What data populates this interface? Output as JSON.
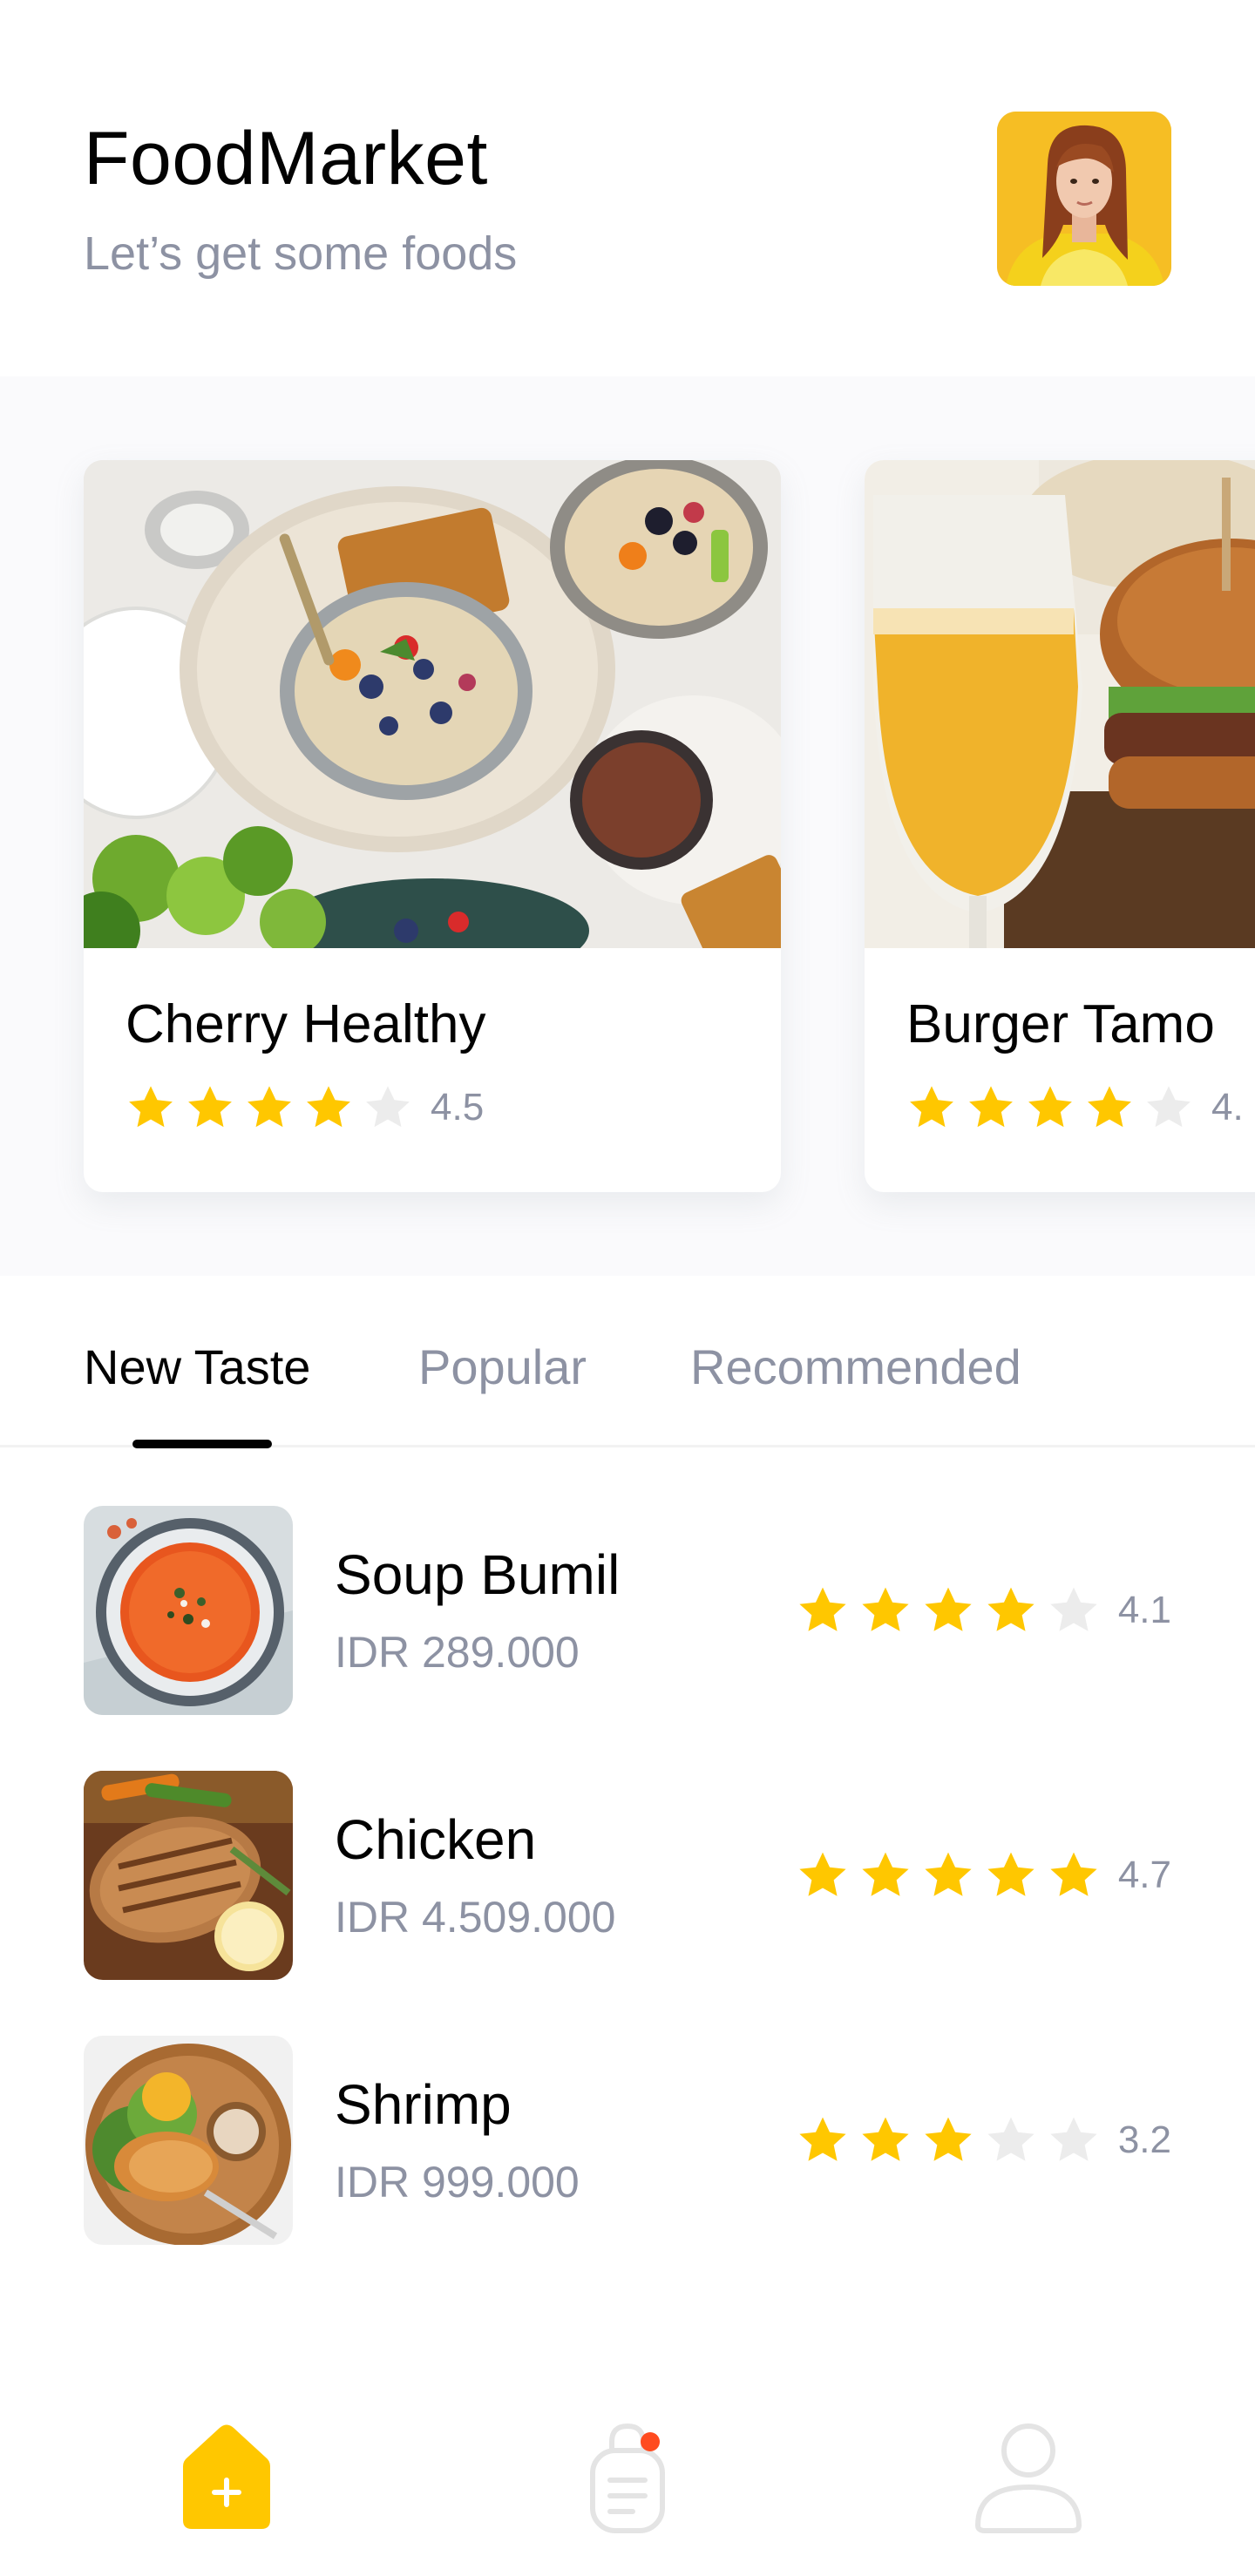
{
  "header": {
    "title": "FoodMarket",
    "subtitle": "Let’s get some foods"
  },
  "colors": {
    "accent": "#FFC700",
    "star_empty": "#ECECEC",
    "muted_text": "#8D92A3",
    "notification_dot": "#FF4B1F"
  },
  "featured": [
    {
      "name": "Cherry Healthy",
      "rating": "4.5",
      "stars": 4
    },
    {
      "name": "Burger Tamo",
      "rating": "4.",
      "stars": 4
    }
  ],
  "tabs": [
    {
      "label": "New Taste",
      "active": true
    },
    {
      "label": "Popular",
      "active": false
    },
    {
      "label": "Recommended",
      "active": false
    }
  ],
  "foods": [
    {
      "name": "Soup Bumil",
      "price": "IDR 289.000",
      "rating": "4.1",
      "stars": 4
    },
    {
      "name": "Chicken",
      "price": "IDR 4.509.000",
      "rating": "4.7",
      "stars": 5
    },
    {
      "name": "Shrimp",
      "price": "IDR 999.000",
      "rating": "3.2",
      "stars": 3
    }
  ],
  "nav": {
    "items": [
      "home-icon",
      "order-bag-icon",
      "profile-icon"
    ]
  }
}
